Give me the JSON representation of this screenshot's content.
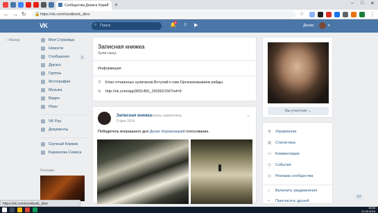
{
  "browser": {
    "tab_title": "Сообщества Дениса Корже",
    "url": "https://vk.com/nootbook_dino",
    "new_tab": "+",
    "close": "×",
    "win_min": "–",
    "win_max": "□",
    "win_close": "✕"
  },
  "header": {
    "logo": "VK",
    "search_placeholder": "Поиск",
    "notification_count": "9",
    "user_name": "Денис"
  },
  "back_label": "Назад",
  "sidebar": {
    "items": [
      {
        "label": "Моя Страница"
      },
      {
        "label": "Новости"
      },
      {
        "label": "Сообщения",
        "count": "1"
      },
      {
        "label": "Друзья"
      },
      {
        "label": "Группы"
      },
      {
        "label": "Фотографии"
      },
      {
        "label": "Музыка"
      },
      {
        "label": "Видео"
      },
      {
        "label": "Игры"
      }
    ],
    "items2": [
      {
        "label": "VK Pay"
      },
      {
        "label": "Документы"
      }
    ],
    "items3": [
      {
        "label": "Скучный Коржик"
      },
      {
        "label": "Барахолка Севаса"
      }
    ],
    "ads_label": "Реклама"
  },
  "group": {
    "title": "Записная книжка",
    "status": "Хули гань)",
    "info_tab": "Информация",
    "description": "Клан отчаянных хулиганов.Вступай к нам.Организовываем рейды.",
    "link": "http://vk.com/app3831450_190362156?ref=9"
  },
  "post": {
    "author": "Записная книжка",
    "pinned": "запись закреплена",
    "date": "5 фев 2014",
    "text_before": "Победитель вчерашнего дня ",
    "text_link": "Денис Корженицкий",
    "text_after": " голосование."
  },
  "right": {
    "join_button": "Вы участник ⌄",
    "manage": [
      {
        "label": "Управление",
        "icon": "gear-icon"
      },
      {
        "label": "Статистика",
        "icon": "stats-icon"
      },
      {
        "label": "Комментарии",
        "icon": "comment-icon"
      },
      {
        "label": "События",
        "icon": "event-icon"
      },
      {
        "label": "Реклама сообщества",
        "icon": "ads-icon"
      },
      {
        "label": "Включить уведомления",
        "icon": "bell-icon"
      },
      {
        "label": "Пригласить друзей",
        "icon": "invite-icon"
      }
    ]
  },
  "pager": "1/2",
  "status_bar_url": "https://vk.com/nootbook_dino",
  "clock": {
    "time": "16:08",
    "date": "22.05.2018"
  }
}
